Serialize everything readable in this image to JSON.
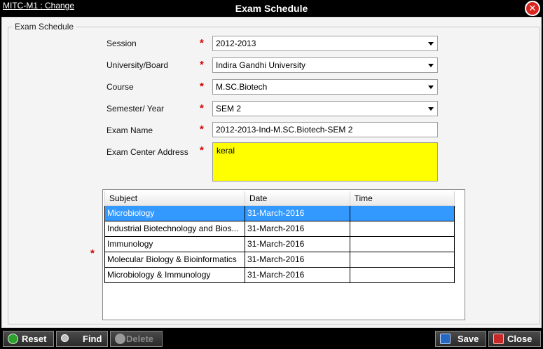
{
  "window": {
    "link": "MITC-M1 : Change",
    "title": "Exam Schedule",
    "close_glyph": "✕"
  },
  "form": {
    "legend": "Exam Schedule",
    "session_label": "Session",
    "session_value": "2012-2013",
    "university_label": "University/Board",
    "university_value": "Indira Gandhi University",
    "course_label": "Course",
    "course_value": "M.SC.Biotech",
    "semester_label": "Semester/ Year",
    "semester_value": "SEM 2",
    "exam_name_label": "Exam Name",
    "exam_name_value": "2012-2013-Ind-M.SC.Biotech-SEM 2",
    "center_label": "Exam Center Address",
    "center_value": "keral",
    "required_mark": "*"
  },
  "grid": {
    "headers": [
      "Subject",
      "Date",
      "Time"
    ],
    "rows": [
      {
        "subject": "Microbiology",
        "date": "31-March-2016",
        "time": ""
      },
      {
        "subject": "Industrial Biotechnology and Bios...",
        "date": "31-March-2016",
        "time": ""
      },
      {
        "subject": "Immunology",
        "date": "31-March-2016",
        "time": ""
      },
      {
        "subject": "Molecular Biology & Bioinformatics",
        "date": "31-March-2016",
        "time": ""
      },
      {
        "subject": "Microbiology & Immunology",
        "date": "31-March-2016",
        "time": ""
      }
    ],
    "selected_row": 0
  },
  "toolbar": {
    "reset": "Reset",
    "find": "Find",
    "delete": "Delete",
    "save": "Save",
    "close": "Close"
  },
  "colors": {
    "highlight": "#3399ff",
    "address_bg": "#ffff00",
    "required": "#d40000"
  }
}
